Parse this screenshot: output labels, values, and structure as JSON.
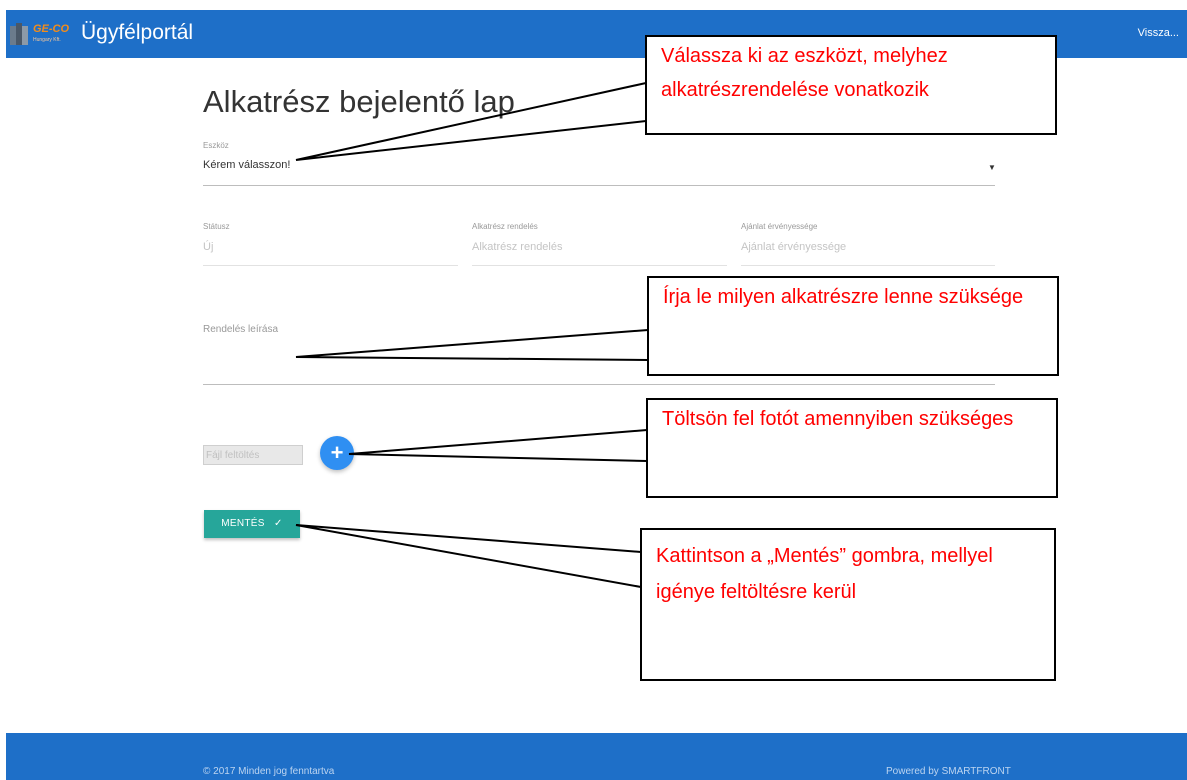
{
  "header": {
    "logo_text": "GE-CO",
    "logo_sub": "Hungary Kft.",
    "app_title": "Ügyfélportál",
    "back_label": "Vissza..."
  },
  "form": {
    "title": "Alkatrész bejelentő lap",
    "device": {
      "label": "Eszköz",
      "value": "Kérem válasszon!"
    },
    "status": {
      "label": "Státusz",
      "value": "Új"
    },
    "part_order": {
      "label": "Alkatrész rendelés",
      "placeholder": "Alkatrész rendelés"
    },
    "offer_validity": {
      "label": "Ajánlat érvényessége",
      "placeholder": "Ajánlat érvényessége"
    },
    "order_description": {
      "label": "Rendelés leírása"
    },
    "file_upload": {
      "placeholder": "Fájl feltöltés"
    },
    "add_button": "+",
    "save_button": "MENTÉS",
    "save_icon": "✓"
  },
  "callouts": {
    "device": "Válassza ki az eszközt, melyhez alkatrészrendelése vonatkozik",
    "description": "Írja le milyen alkatrészre lenne szüksége",
    "upload": "Töltsön fel fotót amennyiben szükséges",
    "save": "Kattintson a „Mentés” gombra, mellyel igénye feltöltésre kerül"
  },
  "footer": {
    "copyright": "© 2017 Minden jog fenntartva",
    "powered_by": "Powered by SMARTFRONT"
  },
  "colors": {
    "brand_blue": "#1e6fc8",
    "save_green": "#26a69a",
    "add_blue": "#2f8ff2",
    "callout_text": "#ff0000"
  },
  "icons": [
    "logo-icon",
    "dropdown-caret-icon",
    "plus-icon",
    "check-icon"
  ]
}
